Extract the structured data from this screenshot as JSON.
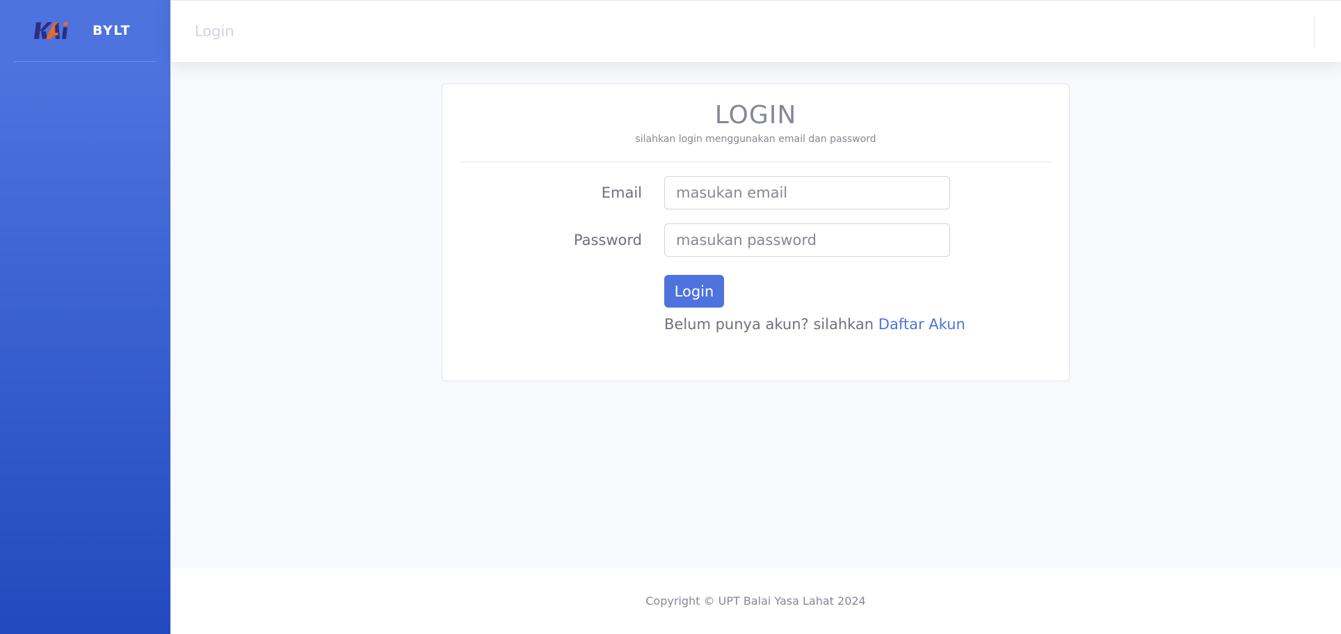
{
  "sidebar": {
    "logo_text": "KAI",
    "brand": "BYLT"
  },
  "topbar": {
    "title": "Login"
  },
  "card": {
    "title": "LOGIN",
    "subtitle": "silahkan login menggunakan email dan password"
  },
  "form": {
    "email_label": "Email",
    "email_placeholder": "masukan email",
    "password_label": "Password",
    "password_placeholder": "masukan password",
    "login_button": "Login",
    "register_prompt": "Belum punya akun? silahkan",
    "register_link": "Daftar Akun"
  },
  "footer": {
    "copyright": "Copyright © UPT Balai Yasa Lahat 2024"
  },
  "colors": {
    "primary": "#4e73df",
    "sidebar_gradient_start": "#4e73df",
    "sidebar_gradient_end": "#224abe",
    "logo_navy": "#2b2e83",
    "logo_orange": "#ed6b21"
  }
}
